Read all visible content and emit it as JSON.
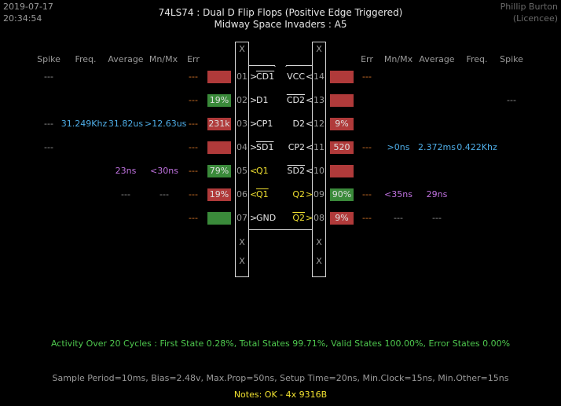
{
  "header": {
    "date": "2019-07-17",
    "time": "20:34:54",
    "title": "74LS74  :  Dual D Flip Flops (Positive Edge Triggered)",
    "subtitle": "Midway Space Invaders : A5",
    "author": "Phillip Burton",
    "licence": "(Licencee)"
  },
  "columns": {
    "spike": "Spike",
    "freq": "Freq.",
    "average": "Average",
    "mnmx": "Mn/Mx",
    "err": "Err"
  },
  "left_rows": [
    {
      "spike": "---",
      "freq": "",
      "average": "",
      "mnmx": "",
      "err": "---",
      "box": "",
      "pin": "01",
      "name": "CD1",
      "dir": ">",
      "bar": true
    },
    {
      "spike": "",
      "freq": "",
      "average": "",
      "mnmx": "",
      "err": "---",
      "box": "19%",
      "pin": "02",
      "name": "D1",
      "dir": ">",
      "bar": false
    },
    {
      "spike": "---",
      "freq": "31.249Khz",
      "average": "31.82us",
      "mnmx": ">12.63us",
      "err": "---",
      "box": "231k",
      "pin": "03",
      "name": "CP1",
      "dir": ">",
      "bar": false
    },
    {
      "spike": "---",
      "freq": "",
      "average": "",
      "mnmx": "",
      "err": "---",
      "box": "",
      "pin": "04",
      "name": "SD1",
      "dir": ">",
      "bar": true
    },
    {
      "spike": "",
      "freq": "",
      "average": "23ns",
      "mnmx": "<30ns",
      "err": "---",
      "box": "79%",
      "pin": "05",
      "name": "Q1",
      "dir": "<",
      "bar": false
    },
    {
      "spike": "",
      "freq": "",
      "average": "---",
      "mnmx": "---",
      "err": "---",
      "box": "19%",
      "pin": "06",
      "name": "Q1",
      "dir": "<",
      "bar": true
    },
    {
      "spike": "",
      "freq": "",
      "average": "",
      "mnmx": "",
      "err": "---",
      "box": "",
      "pin": "07",
      "name": "GND",
      "dir": ">",
      "bar": false
    }
  ],
  "right_rows": [
    {
      "pin": "14",
      "name": "VCC",
      "dir": "<",
      "bar": false,
      "box": "",
      "err": "---",
      "mnmx": "",
      "average": "",
      "freq": "",
      "spike": ""
    },
    {
      "pin": "13",
      "name": "CD2",
      "dir": "<",
      "bar": true,
      "box": "",
      "err": "",
      "mnmx": "",
      "average": "",
      "freq": "",
      "spike": "---"
    },
    {
      "pin": "12",
      "name": "D2",
      "dir": "<",
      "bar": false,
      "box": "9%",
      "err": "",
      "mnmx": "",
      "average": "",
      "freq": "",
      "spike": ""
    },
    {
      "pin": "11",
      "name": "CP2",
      "dir": "<",
      "bar": false,
      "box": "520",
      "err": "---",
      "mnmx": ">0ns",
      "average": "2.372ms",
      "freq": "0.422Khz",
      "spike": ""
    },
    {
      "pin": "10",
      "name": "SD2",
      "dir": "<",
      "bar": true,
      "box": "",
      "err": "",
      "mnmx": "",
      "average": "",
      "freq": "",
      "spike": ""
    },
    {
      "pin": "09",
      "name": "Q2",
      "dir": ">",
      "bar": false,
      "box": "90%",
      "err": "---",
      "mnmx": "<35ns",
      "average": "29ns",
      "freq": "",
      "spike": ""
    },
    {
      "pin": "08",
      "name": "Q2",
      "dir": ">",
      "bar": true,
      "box": "9%",
      "err": "---",
      "mnmx": "---",
      "average": "---",
      "freq": "",
      "spike": ""
    }
  ],
  "x_mark": "X",
  "activity": "Activity Over 20 Cycles  :  First State 0.28%,  Total States 99.71%,  Valid States 100.00%,  Error States 0.00%",
  "sample": "Sample Period=10ms,  Bias=2.48v,  Max.Prop=50ns,  Setup Time=20ns,  Min.Clock=15ns,  Min.Other=15ns",
  "notes": "Notes:  OK - 4x 9316B",
  "colors": {
    "red_box": "#b03a3a",
    "green_box": "#3a8a3a",
    "blue_text": "#4faee8",
    "purple_text": "#c072e0",
    "orange_err": "#e07a2a",
    "yellow_q": "#f0e030",
    "green_activity": "#4ec84e"
  }
}
